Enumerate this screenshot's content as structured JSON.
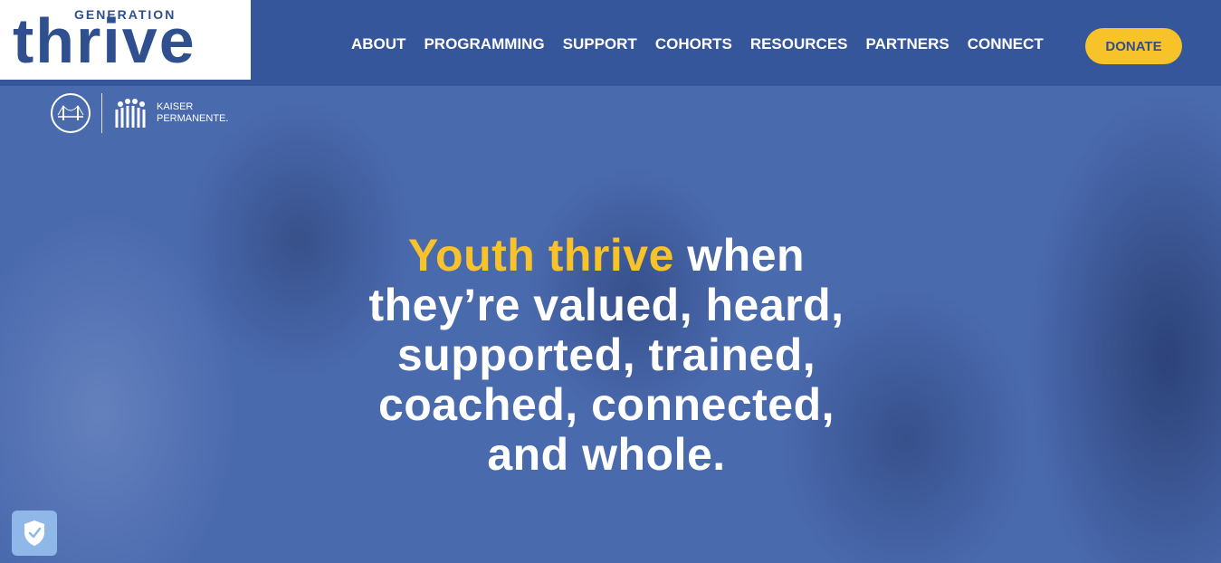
{
  "logo": {
    "small": "GENERATION",
    "large": "thrive"
  },
  "nav": {
    "items": [
      "ABOUT",
      "PROGRAMMING",
      "SUPPORT",
      "COHORTS",
      "RESOURCES",
      "PARTNERS",
      "CONNECT"
    ],
    "donate_label": "DONATE"
  },
  "partners": {
    "kaiser_line1": "KAISER",
    "kaiser_line2": "PERMANENTE."
  },
  "hero": {
    "headline_accent": "Youth thrive",
    "headline_rest_1": " when",
    "headline_rest_2": "they’re valued, heard,",
    "headline_rest_3": "supported, trained,",
    "headline_rest_4": "coached, connected,",
    "headline_rest_5": "and whole."
  },
  "colors": {
    "brand_blue": "#35569a",
    "accent_yellow": "#f8c22a",
    "shield_blue": "#8fb7e8"
  },
  "icons": {
    "accessibility": "shield-check-icon"
  }
}
